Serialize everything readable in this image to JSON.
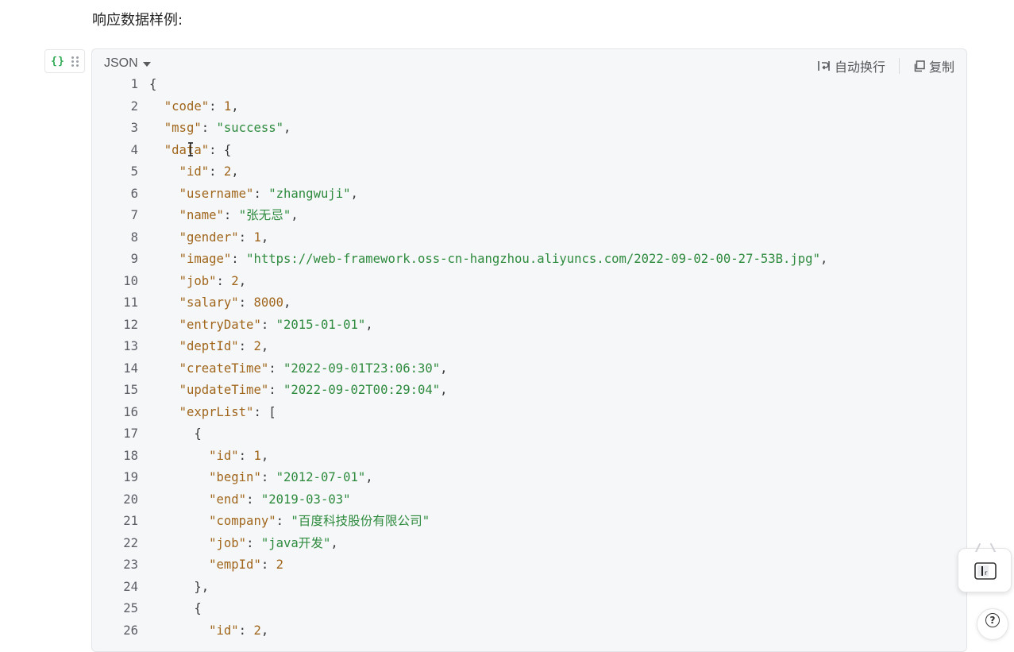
{
  "heading": "响应数据样例:",
  "code_block": {
    "language": "JSON",
    "wrap_label": "自动换行",
    "copy_label": "复制",
    "lines": [
      {
        "no": "1",
        "tokens": [
          {
            "t": "p",
            "v": "{"
          }
        ]
      },
      {
        "no": "2",
        "tokens": [
          {
            "t": "p",
            "v": "  "
          },
          {
            "t": "k",
            "v": "\"code\""
          },
          {
            "t": "p",
            "v": ": "
          },
          {
            "t": "n",
            "v": "1"
          },
          {
            "t": "p",
            "v": ","
          }
        ]
      },
      {
        "no": "3",
        "tokens": [
          {
            "t": "p",
            "v": "  "
          },
          {
            "t": "k",
            "v": "\"msg\""
          },
          {
            "t": "p",
            "v": ": "
          },
          {
            "t": "s",
            "v": "\"success\""
          },
          {
            "t": "p",
            "v": ","
          }
        ]
      },
      {
        "no": "4",
        "tokens": [
          {
            "t": "p",
            "v": "  "
          },
          {
            "t": "k",
            "v": "\"data\""
          },
          {
            "t": "p",
            "v": ": {"
          }
        ]
      },
      {
        "no": "5",
        "tokens": [
          {
            "t": "p",
            "v": "    "
          },
          {
            "t": "k",
            "v": "\"id\""
          },
          {
            "t": "p",
            "v": ": "
          },
          {
            "t": "n",
            "v": "2"
          },
          {
            "t": "p",
            "v": ","
          }
        ]
      },
      {
        "no": "6",
        "tokens": [
          {
            "t": "p",
            "v": "    "
          },
          {
            "t": "k",
            "v": "\"username\""
          },
          {
            "t": "p",
            "v": ": "
          },
          {
            "t": "s",
            "v": "\"zhangwuji\""
          },
          {
            "t": "p",
            "v": ","
          }
        ]
      },
      {
        "no": "7",
        "tokens": [
          {
            "t": "p",
            "v": "    "
          },
          {
            "t": "k",
            "v": "\"name\""
          },
          {
            "t": "p",
            "v": ": "
          },
          {
            "t": "s",
            "v": "\"张无忌\""
          },
          {
            "t": "p",
            "v": ","
          }
        ]
      },
      {
        "no": "8",
        "tokens": [
          {
            "t": "p",
            "v": "    "
          },
          {
            "t": "k",
            "v": "\"gender\""
          },
          {
            "t": "p",
            "v": ": "
          },
          {
            "t": "n",
            "v": "1"
          },
          {
            "t": "p",
            "v": ","
          }
        ]
      },
      {
        "no": "9",
        "tokens": [
          {
            "t": "p",
            "v": "    "
          },
          {
            "t": "k",
            "v": "\"image\""
          },
          {
            "t": "p",
            "v": ": "
          },
          {
            "t": "s",
            "v": "\"https://web-framework.oss-cn-hangzhou.aliyuncs.com/2022-09-02-00-27-53B.jpg\""
          },
          {
            "t": "p",
            "v": ","
          }
        ]
      },
      {
        "no": "10",
        "tokens": [
          {
            "t": "p",
            "v": "    "
          },
          {
            "t": "k",
            "v": "\"job\""
          },
          {
            "t": "p",
            "v": ": "
          },
          {
            "t": "n",
            "v": "2"
          },
          {
            "t": "p",
            "v": ","
          }
        ]
      },
      {
        "no": "11",
        "tokens": [
          {
            "t": "p",
            "v": "    "
          },
          {
            "t": "k",
            "v": "\"salary\""
          },
          {
            "t": "p",
            "v": ": "
          },
          {
            "t": "n",
            "v": "8000"
          },
          {
            "t": "p",
            "v": ","
          }
        ]
      },
      {
        "no": "12",
        "tokens": [
          {
            "t": "p",
            "v": "    "
          },
          {
            "t": "k",
            "v": "\"entryDate\""
          },
          {
            "t": "p",
            "v": ": "
          },
          {
            "t": "s",
            "v": "\"2015-01-01\""
          },
          {
            "t": "p",
            "v": ","
          }
        ]
      },
      {
        "no": "13",
        "tokens": [
          {
            "t": "p",
            "v": "    "
          },
          {
            "t": "k",
            "v": "\"deptId\""
          },
          {
            "t": "p",
            "v": ": "
          },
          {
            "t": "n",
            "v": "2"
          },
          {
            "t": "p",
            "v": ","
          }
        ]
      },
      {
        "no": "14",
        "tokens": [
          {
            "t": "p",
            "v": "    "
          },
          {
            "t": "k",
            "v": "\"createTime\""
          },
          {
            "t": "p",
            "v": ": "
          },
          {
            "t": "s",
            "v": "\"2022-09-01T23:06:30\""
          },
          {
            "t": "p",
            "v": ","
          }
        ]
      },
      {
        "no": "15",
        "tokens": [
          {
            "t": "p",
            "v": "    "
          },
          {
            "t": "k",
            "v": "\"updateTime\""
          },
          {
            "t": "p",
            "v": ": "
          },
          {
            "t": "s",
            "v": "\"2022-09-02T00:29:04\""
          },
          {
            "t": "p",
            "v": ","
          }
        ]
      },
      {
        "no": "16",
        "tokens": [
          {
            "t": "p",
            "v": "    "
          },
          {
            "t": "k",
            "v": "\"exprList\""
          },
          {
            "t": "p",
            "v": ": ["
          }
        ]
      },
      {
        "no": "17",
        "tokens": [
          {
            "t": "p",
            "v": "      {"
          }
        ]
      },
      {
        "no": "18",
        "tokens": [
          {
            "t": "p",
            "v": "        "
          },
          {
            "t": "k",
            "v": "\"id\""
          },
          {
            "t": "p",
            "v": ": "
          },
          {
            "t": "n",
            "v": "1"
          },
          {
            "t": "p",
            "v": ","
          }
        ]
      },
      {
        "no": "19",
        "tokens": [
          {
            "t": "p",
            "v": "        "
          },
          {
            "t": "k",
            "v": "\"begin\""
          },
          {
            "t": "p",
            "v": ": "
          },
          {
            "t": "s",
            "v": "\"2012-07-01\""
          },
          {
            "t": "p",
            "v": ","
          }
        ]
      },
      {
        "no": "20",
        "tokens": [
          {
            "t": "p",
            "v": "        "
          },
          {
            "t": "k",
            "v": "\"end\""
          },
          {
            "t": "p",
            "v": ": "
          },
          {
            "t": "s",
            "v": "\"2019-03-03\""
          }
        ]
      },
      {
        "no": "21",
        "tokens": [
          {
            "t": "p",
            "v": "        "
          },
          {
            "t": "k",
            "v": "\"company\""
          },
          {
            "t": "p",
            "v": ": "
          },
          {
            "t": "s",
            "v": "\"百度科技股份有限公司\""
          }
        ]
      },
      {
        "no": "22",
        "tokens": [
          {
            "t": "p",
            "v": "        "
          },
          {
            "t": "k",
            "v": "\"job\""
          },
          {
            "t": "p",
            "v": ": "
          },
          {
            "t": "s",
            "v": "\"java开发\""
          },
          {
            "t": "p",
            "v": ","
          }
        ]
      },
      {
        "no": "23",
        "tokens": [
          {
            "t": "p",
            "v": "        "
          },
          {
            "t": "k",
            "v": "\"empId\""
          },
          {
            "t": "p",
            "v": ": "
          },
          {
            "t": "n",
            "v": "2"
          }
        ]
      },
      {
        "no": "24",
        "tokens": [
          {
            "t": "p",
            "v": "      },"
          }
        ]
      },
      {
        "no": "25",
        "tokens": [
          {
            "t": "p",
            "v": "      {"
          }
        ]
      },
      {
        "no": "26",
        "tokens": [
          {
            "t": "p",
            "v": "        "
          },
          {
            "t": "k",
            "v": "\"id\""
          },
          {
            "t": "p",
            "v": ": "
          },
          {
            "t": "n",
            "v": "2"
          },
          {
            "t": "p",
            "v": ","
          }
        ]
      }
    ]
  },
  "help_label": "?",
  "colors": {
    "key": "#a0661b",
    "string": "#2e8b3e",
    "number": "#a0661b",
    "block_icon": "#2eaa52",
    "code_bg": "#f6f7f9"
  },
  "icons": [
    "code-braces-icon",
    "drag-handle-icon",
    "caret-down-icon",
    "word-wrap-icon",
    "copy-icon",
    "help-icon",
    "bilibili-tv-icon"
  ]
}
